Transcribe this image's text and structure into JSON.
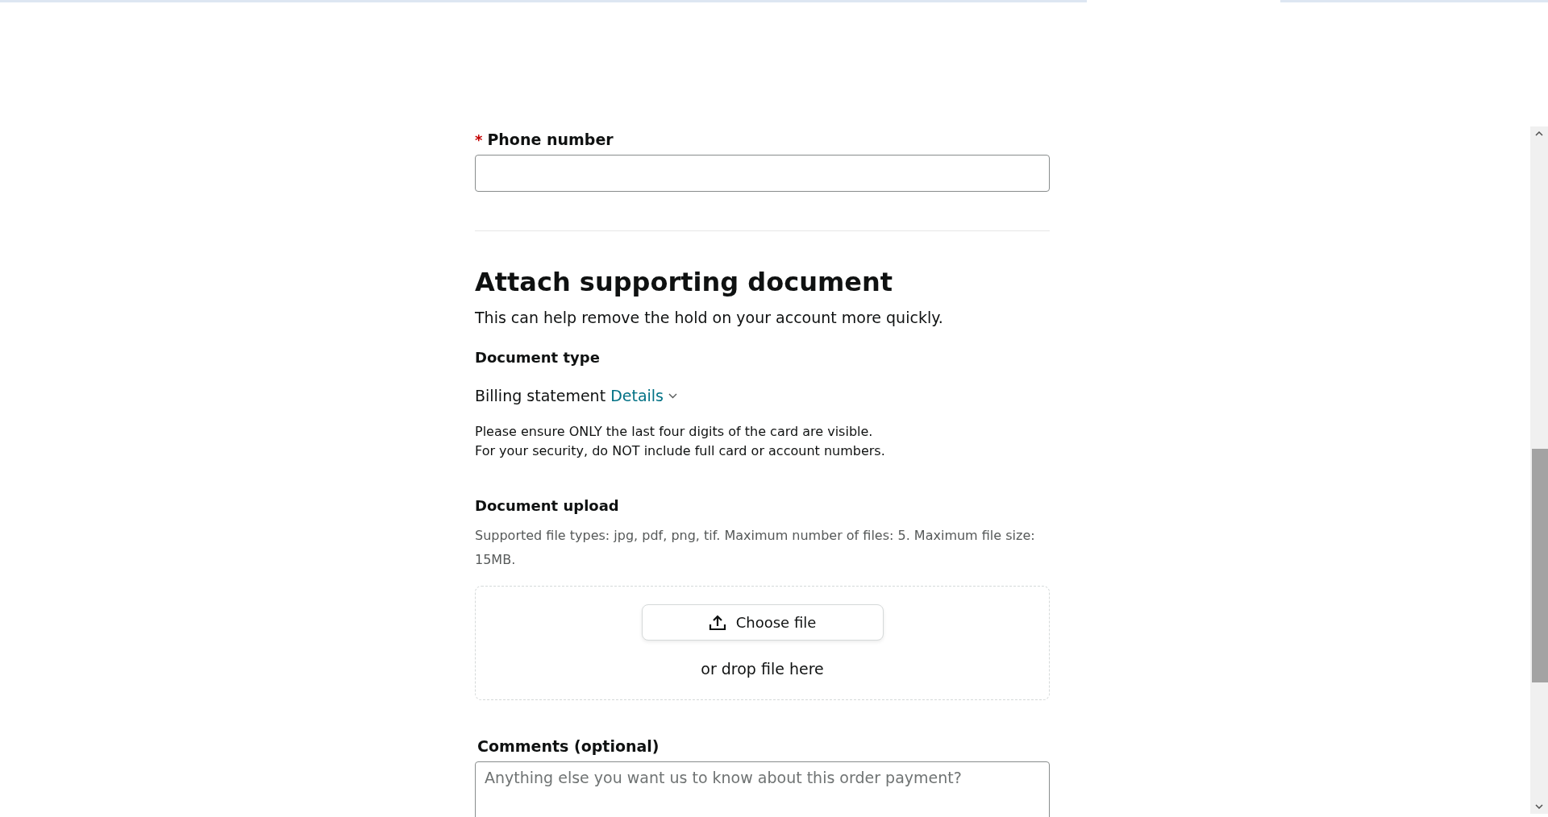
{
  "phone": {
    "required_mark": "*",
    "label": "Phone number"
  },
  "attach": {
    "title": "Attach supporting document",
    "subtitle": "This can help remove the hold on your account more quickly."
  },
  "document_type": {
    "label": "Document type",
    "value": "Billing statement",
    "details_link": "Details",
    "expanded": false,
    "notes": [
      "Please ensure ONLY the last four digits of the card are visible.",
      "For your security, do NOT include full card or account numbers."
    ]
  },
  "upload": {
    "label": "Document upload",
    "hint": "Supported file types: jpg, pdf, png, tif. Maximum number of files: 5. Maximum file size: 15MB.",
    "button": "Choose file",
    "drop_text": "or drop file here"
  },
  "comments": {
    "label": "Comments (optional)",
    "placeholder": "Anything else you want us to know about this order payment?"
  }
}
